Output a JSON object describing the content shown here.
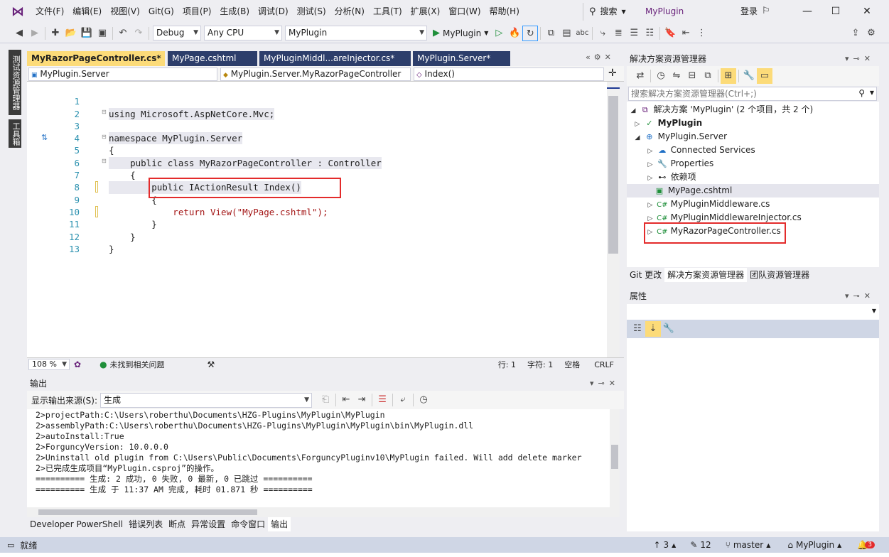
{
  "menu": [
    "文件(F)",
    "编辑(E)",
    "视图(V)",
    "Git(G)",
    "项目(P)",
    "生成(B)",
    "调试(D)",
    "测试(S)",
    "分析(N)",
    "工具(T)",
    "扩展(X)",
    "窗口(W)",
    "帮助(H)"
  ],
  "search_label": "搜索",
  "solution_name": "MyPlugin",
  "login_label": "登录",
  "toolbar": {
    "config": "Debug",
    "platform": "Any CPU",
    "project": "MyPlugin",
    "run_label": "MyPlugin"
  },
  "side_tabs": [
    "测试资源管理器",
    "工具箱"
  ],
  "tabs": [
    {
      "label": "MyRazorPageController.cs*"
    },
    {
      "label": "MyPage.cshtml"
    },
    {
      "label": "MyPluginMiddl...areInjector.cs*"
    },
    {
      "label": "MyPlugin.Server*"
    }
  ],
  "nav": {
    "project": "MyPlugin.Server",
    "class": "MyPlugin.Server.MyRazorPageController",
    "member": "Index()"
  },
  "code": [
    {
      "n": "1",
      "t": "using Microsoft.AspNetCore.Mvc;"
    },
    {
      "n": "2",
      "t": ""
    },
    {
      "n": "3",
      "t": "namespace MyPlugin.Server"
    },
    {
      "n": "4",
      "t": "{"
    },
    {
      "n": "5",
      "t": "    public class MyRazorPageController : Controller"
    },
    {
      "n": "6",
      "t": "    {"
    },
    {
      "n": "7",
      "t": "        public IActionResult Index()"
    },
    {
      "n": "8",
      "t": "        {"
    },
    {
      "n": "9",
      "t": "            return View(\"MyPage.cshtml\");"
    },
    {
      "n": "10",
      "t": "        }"
    },
    {
      "n": "11",
      "t": "    }"
    },
    {
      "n": "12",
      "t": "}"
    },
    {
      "n": "13",
      "t": ""
    }
  ],
  "editor_status": {
    "zoom": "108 %",
    "issues": "未找到相关问题",
    "line": "行: 1",
    "char": "字符: 1",
    "space": "空格",
    "eol": "CRLF"
  },
  "output": {
    "title": "输出",
    "source_label": "显示输出来源(S):",
    "source_value": "生成",
    "lines": [
      "2>projectPath:C:\\Users\\roberthu\\Documents\\HZG-Plugins\\MyPlugin\\MyPlugin",
      "2>assemblyPath:C:\\Users\\roberthu\\Documents\\HZG-Plugins\\MyPlugin\\MyPlugin\\bin\\MyPlugin.dll",
      "2>autoInstall:True",
      "2>ForguncyVersion: 10.0.0.0",
      "2>Uninstall old plugin from C:\\Users\\Public\\Documents\\ForguncyPluginv10\\MyPlugin failed. Will add delete marker",
      "2>已完成生成项目“MyPlugin.csproj”的操作。",
      "========== 生成: 2 成功, 0 失败, 0 最新, 0 已跳过 ==========",
      "========== 生成 于 11:37 AM 完成, 耗时 01.871 秒 =========="
    ]
  },
  "bottom_tabs": [
    "Developer PowerShell",
    "错误列表",
    "断点",
    "异常设置",
    "命令窗口",
    "输出"
  ],
  "solution_explorer": {
    "title": "解决方案资源管理器",
    "search_placeholder": "搜索解决方案资源管理器(Ctrl+;)",
    "items": [
      {
        "label": "解决方案 'MyPlugin' (2 个项目，共 2 个)"
      },
      {
        "label": "MyPlugin"
      },
      {
        "label": "MyPlugin.Server"
      },
      {
        "label": "Connected Services"
      },
      {
        "label": "Properties"
      },
      {
        "label": "依赖项"
      },
      {
        "label": "MyPage.cshtml"
      },
      {
        "label": "MyPluginMiddleware.cs"
      },
      {
        "label": "MyPluginMiddlewareInjector.cs"
      },
      {
        "label": "MyRazorPageController.cs"
      }
    ],
    "tabs": [
      "Git 更改",
      "解决方案资源管理器",
      "团队资源管理器"
    ]
  },
  "properties": {
    "title": "属性"
  },
  "statusbar": {
    "ready": "就绪",
    "up_count": "3",
    "edit_count": "12",
    "branch": "master",
    "repo": "MyPlugin",
    "notif": "3"
  },
  "colors": {
    "accent": "#68217a",
    "active_tab": "#fcdb79",
    "highlight_box": "#e32b2b"
  }
}
